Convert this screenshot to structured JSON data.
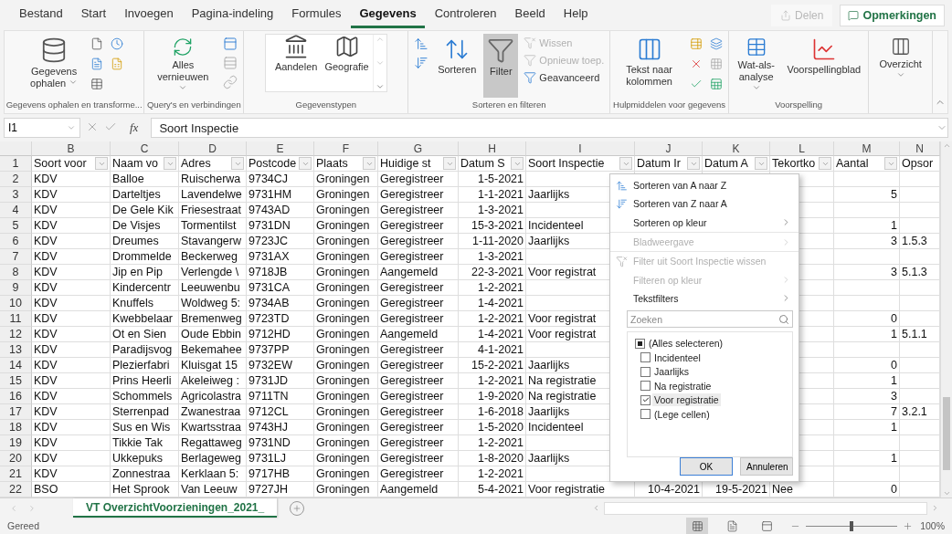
{
  "ribbon_tabs": [
    {
      "label": "Bestand",
      "selected": false
    },
    {
      "label": "Start",
      "selected": false
    },
    {
      "label": "Invoegen",
      "selected": false
    },
    {
      "label": "Pagina-indeling",
      "selected": false
    },
    {
      "label": "Formules",
      "selected": false
    },
    {
      "label": "Gegevens",
      "selected": true
    },
    {
      "label": "Controleren",
      "selected": false
    },
    {
      "label": "Beeld",
      "selected": false
    },
    {
      "label": "Help",
      "selected": false
    }
  ],
  "share_button": {
    "label": "Delen",
    "disabled": true
  },
  "comments_button": {
    "label": "Opmerkingen"
  },
  "ribbon_groups": [
    {
      "kind": "get-data",
      "label": "Gegevens ophalen en transforme...",
      "controls": [
        {
          "label": "Gegevens ophalen",
          "dropdown": true,
          "disabled": false
        }
      ]
    },
    {
      "kind": "queries",
      "label": "Query's en verbindingen",
      "controls": [
        {
          "label": "Alles vernieuwen",
          "dropdown": true,
          "disabled": false
        }
      ]
    },
    {
      "kind": "datatypes",
      "label": "Gegevenstypen",
      "controls": [
        {
          "label": "Aandelen",
          "disabled": false
        },
        {
          "label": "Geografie",
          "disabled": false
        }
      ]
    },
    {
      "kind": "sort-filter",
      "label": "Sorteren en filteren",
      "controls": [
        {
          "label": "Sorteren",
          "disabled": false
        },
        {
          "label": "Filter",
          "disabled": false,
          "on": true
        },
        {
          "label": "Wissen",
          "disabled": true
        },
        {
          "label": "Opnieuw toep.",
          "disabled": true
        },
        {
          "label": "Geavanceerd",
          "disabled": false
        }
      ]
    },
    {
      "kind": "data-tools",
      "label": "Hulpmiddelen voor gegevens",
      "controls": [
        {
          "label": "Tekst naar kolommen",
          "disabled": false
        }
      ]
    },
    {
      "kind": "forecast",
      "label": "Voorspelling",
      "controls": [
        {
          "label": "Wat-als-analyse",
          "dropdown": true,
          "disabled": false
        },
        {
          "label": "Voorspellingblad",
          "dropdown": false,
          "disabled": false
        }
      ]
    },
    {
      "kind": "outline",
      "controls": [
        {
          "label": "Overzicht",
          "dropdown": true,
          "disabled": false
        }
      ]
    }
  ],
  "formula_bar": {
    "name_box": "I1",
    "function_label": "fx",
    "value": "Soort Inspectie"
  },
  "table": {
    "columns": [
      {
        "letter": "B",
        "header": "Soort voor"
      },
      {
        "letter": "C",
        "header": "Naam vo"
      },
      {
        "letter": "D",
        "header": "Adres"
      },
      {
        "letter": "E",
        "header": "Postcode"
      },
      {
        "letter": "F",
        "header": "Plaats"
      },
      {
        "letter": "G",
        "header": "Huidige st"
      },
      {
        "letter": "H",
        "header": "Datum S"
      },
      {
        "letter": "I",
        "header": "Soort Inspectie"
      },
      {
        "letter": "J",
        "header": "Datum Ir"
      },
      {
        "letter": "K",
        "header": "Datum A"
      },
      {
        "letter": "L",
        "header": "Tekortko"
      },
      {
        "letter": "M",
        "header": "Aantal"
      },
      {
        "letter": "N",
        "header": "Opsor"
      }
    ],
    "header_row": "1",
    "rows": [
      {
        "number": "2",
        "cells": {
          "b": "KDV",
          "c": "Balloe",
          "d": "Ruischerwa",
          "e": "9734CJ",
          "f": "Groningen",
          "g": "Geregistreer",
          "h": "1-5-2021"
        }
      },
      {
        "number": "3",
        "cells": {
          "b": "KDV",
          "c": "Darteltjes",
          "d": "Lavendelwe",
          "e": "9731HM",
          "f": "Groningen",
          "g": "Geregistreer",
          "h": "1-1-2021",
          "i": "Jaarlijks",
          "m": "5"
        }
      },
      {
        "number": "4",
        "cells": {
          "b": "KDV",
          "c": "De Gele Kik",
          "d": "Friesestraat",
          "e": "9743AD",
          "f": "Groningen",
          "g": "Geregistreer",
          "h": "1-3-2021"
        }
      },
      {
        "number": "5",
        "cells": {
          "b": "KDV",
          "c": "De Visjes",
          "d": "Tormentilst",
          "e": "9731DN",
          "f": "Groningen",
          "g": "Geregistreer",
          "h": "15-3-2021",
          "i": "Incidenteel",
          "m": "1"
        }
      },
      {
        "number": "6",
        "cells": {
          "b": "KDV",
          "c": "Dreumes",
          "d": "Stavangerw",
          "e": "9723JC",
          "f": "Groningen",
          "g": "Geregistreer",
          "h": "1-11-2020",
          "i": "Jaarlijks",
          "m": "3",
          "n": "1.5.3"
        }
      },
      {
        "number": "7",
        "cells": {
          "b": "KDV",
          "c": "Drommelde",
          "d": "Beckerweg",
          "e": "9731AX",
          "f": "Groningen",
          "g": "Geregistreer",
          "h": "1-3-2021"
        }
      },
      {
        "number": "8",
        "cells": {
          "b": "KDV",
          "c": "Jip en Pip",
          "d": "Verlengde \\",
          "e": "9718JB",
          "f": "Groningen",
          "g": "Aangemeld",
          "h": "22-3-2021",
          "i": "Voor registrat",
          "m": "3",
          "n": "5.1.3"
        }
      },
      {
        "number": "9",
        "cells": {
          "b": "KDV",
          "c": "Kindercentr",
          "d": "Leeuwenbu",
          "e": "9731CA",
          "f": "Groningen",
          "g": "Geregistreer",
          "h": "1-2-2021"
        }
      },
      {
        "number": "10",
        "cells": {
          "b": "KDV",
          "c": "Knuffels",
          "d": "Woldweg 5:",
          "e": "9734AB",
          "f": "Groningen",
          "g": "Geregistreer",
          "h": "1-4-2021"
        }
      },
      {
        "number": "11",
        "cells": {
          "b": "KDV",
          "c": "Kwebbelaar",
          "d": "Bremenweg",
          "e": "9723TD",
          "f": "Groningen",
          "g": "Geregistreer",
          "h": "1-2-2021",
          "i": "Voor registrat",
          "m": "0"
        }
      },
      {
        "number": "12",
        "cells": {
          "b": "KDV",
          "c": "Ot en Sien",
          "d": "Oude Ebbin",
          "e": "9712HD",
          "f": "Groningen",
          "g": "Aangemeld",
          "h": "1-4-2021",
          "i": "Voor registrat",
          "m": "1",
          "n": "5.1.1"
        }
      },
      {
        "number": "13",
        "cells": {
          "b": "KDV",
          "c": "Paradijsvog",
          "d": "Bekemahee",
          "e": "9737PP",
          "f": "Groningen",
          "g": "Geregistreer",
          "h": "4-1-2021"
        }
      },
      {
        "number": "14",
        "cells": {
          "b": "KDV",
          "c": "Plezierfabri",
          "d": "Kluisgat 15",
          "e": "9732EW",
          "f": "Groningen",
          "g": "Geregistreer",
          "h": "15-2-2021",
          "i": "Jaarlijks",
          "m": "0"
        }
      },
      {
        "number": "15",
        "cells": {
          "b": "KDV",
          "c": "Prins Heerli",
          "d": "Akeleiweg :",
          "e": "9731JD",
          "f": "Groningen",
          "g": "Geregistreer",
          "h": "1-2-2021",
          "i": "Na registratie",
          "m": "1"
        }
      },
      {
        "number": "16",
        "cells": {
          "b": "KDV",
          "c": "Schommels",
          "d": "Agricolastra",
          "e": "9711TN",
          "f": "Groningen",
          "g": "Geregistreer",
          "h": "1-9-2020",
          "i": "Na registratie",
          "m": "3"
        }
      },
      {
        "number": "17",
        "cells": {
          "b": "KDV",
          "c": "Sterrenpad",
          "d": "Zwanestraa",
          "e": "9712CL",
          "f": "Groningen",
          "g": "Geregistreer",
          "h": "1-6-2018",
          "i": "Jaarlijks",
          "m": "7",
          "n": "3.2.1"
        }
      },
      {
        "number": "18",
        "cells": {
          "b": "KDV",
          "c": "Sus en Wis",
          "d": "Kwartsstraa",
          "e": "9743HJ",
          "f": "Groningen",
          "g": "Geregistreer",
          "h": "1-5-2020",
          "i": "Incidenteel",
          "m": "1"
        }
      },
      {
        "number": "19",
        "cells": {
          "b": "KDV",
          "c": "Tikkie Tak",
          "d": "Regattaweg",
          "e": "9731ND",
          "f": "Groningen",
          "g": "Geregistreer",
          "h": "1-2-2021"
        }
      },
      {
        "number": "20",
        "cells": {
          "b": "KDV",
          "c": "Ukkepuks",
          "d": "Berlageweg",
          "e": "9731LJ",
          "f": "Groningen",
          "g": "Geregistreer",
          "h": "1-8-2020",
          "i": "Jaarlijks",
          "m": "1"
        }
      },
      {
        "number": "21",
        "cells": {
          "b": "KDV",
          "c": "Zonnestraa",
          "d": "Kerklaan 5:",
          "e": "9717HB",
          "f": "Groningen",
          "g": "Geregistreer",
          "h": "1-2-2021"
        }
      },
      {
        "number": "22",
        "cells": {
          "b": "BSO",
          "c": "Het Sprook",
          "d": "Van Leeuw",
          "e": "9727JH",
          "f": "Groningen",
          "g": "Aangemeld",
          "h": "5-4-2021",
          "i": "Voor registratie",
          "j": "10-4-2021",
          "k": "19-5-2021",
          "l": "Nee",
          "m": "0"
        }
      }
    ]
  },
  "filter_menu": {
    "items": [
      {
        "kind": "sort-asc",
        "label": "Sorteren van A naar Z",
        "disabled": false,
        "separator_before": false
      },
      {
        "kind": "sort-desc",
        "label": "Sorteren van Z naar A",
        "disabled": false,
        "separator_before": false
      },
      {
        "kind": "submenu",
        "label": "Sorteren op kleur",
        "disabled": false,
        "separator_before": false
      },
      {
        "kind": "submenu",
        "label": "Bladweergave",
        "disabled": true,
        "separator_before": true
      },
      {
        "kind": "clear-filter",
        "label": "Filter uit Soort Inspectie wissen",
        "disabled": true,
        "separator_before": true
      },
      {
        "kind": "submenu",
        "label": "Filteren op kleur",
        "disabled": true,
        "separator_before": false
      },
      {
        "kind": "submenu",
        "label": "Tekstfilters",
        "disabled": false,
        "separator_before": false
      }
    ],
    "search": {
      "placeholder": "Zoeken"
    },
    "values": [
      {
        "label": "(Alles selecteren)",
        "checked": false,
        "partial": true,
        "selected": false
      },
      {
        "label": "Incidenteel",
        "checked": false,
        "partial": false,
        "selected": false
      },
      {
        "label": "Jaarlijks",
        "checked": false,
        "partial": false,
        "selected": false
      },
      {
        "label": "Na registratie",
        "checked": false,
        "partial": false,
        "selected": false
      },
      {
        "label": "Voor registratie",
        "checked": true,
        "partial": false,
        "selected": true
      },
      {
        "label": "(Lege cellen)",
        "checked": false,
        "partial": false,
        "selected": false
      }
    ],
    "buttons": [
      {
        "label": "OK",
        "default": true
      },
      {
        "label": "Annuleren",
        "default": false
      }
    ]
  },
  "sheet_tabs": [
    {
      "label": "VT OverzichtVoorzieningen_2021_",
      "selected": true
    }
  ],
  "status_bar": {
    "status": "Gereed",
    "views": [
      {
        "selected": true
      },
      {
        "selected": false
      },
      {
        "selected": false
      }
    ],
    "zoom": {
      "level": 0.5,
      "reading": "100%"
    }
  }
}
